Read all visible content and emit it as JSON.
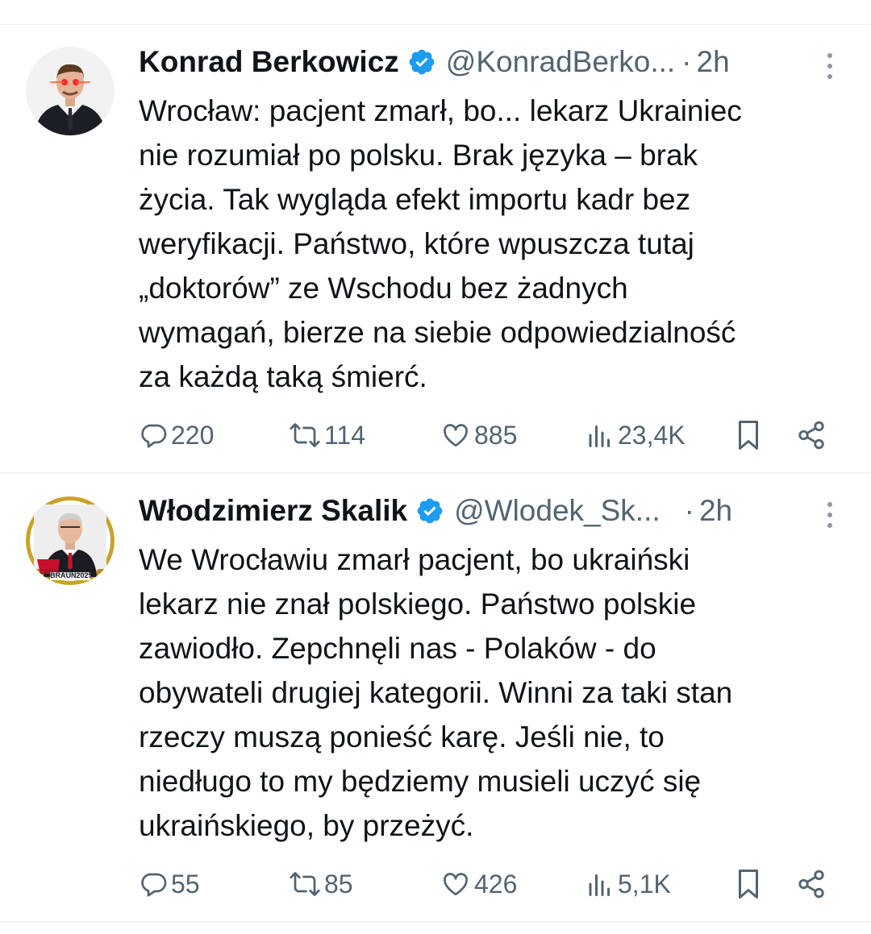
{
  "tweets": [
    {
      "display_name": "Konrad Berkowicz",
      "handle": "@KonradBerko...",
      "dot": "·",
      "time": "2h",
      "text": "Wrocław: pacjent zmarł, bo... lekarz Ukrainiec\nnie rozumiał po polsku. Brak języka – brak\nżycia. Tak wygląda efekt importu kadr bez\nweryfikacji. Państwo, które wpuszcza tutaj\n„doktorów” ze Wschodu bez żadnych\nwymagań, bierze na siebie odpowiedzialność\nza każdą taką śmierć.",
      "replies": "220",
      "reposts": "114",
      "likes": "885",
      "views": "23,4K"
    },
    {
      "display_name": "Włodzimierz Skalik",
      "handle": "@Wlodek_Sk...",
      "dot": "·",
      "time": "2h",
      "text": "We Wrocławiu zmarł pacjent, bo ukraiński\nlekarz nie znał polskiego. Państwo polskie\nzawiodło. Zepchnęli nas - Polaków - do\nobywateli drugiej kategorii. Winni za taki stan\nrzeczy muszą ponieść karę. Jeśli nie, to\nniedługo to my będziemy musieli uczyć się\nukraińskiego, by przeżyć.",
      "replies": "55",
      "reposts": "85",
      "likes": "426",
      "views": "5,1K",
      "avatar_banner": "BRAUN2025"
    }
  ],
  "icons": {
    "verified": "verified-badge-icon",
    "more": "more-vertical-icon",
    "reply": "reply-icon",
    "repost": "repost-icon",
    "like": "like-icon",
    "views": "views-icon",
    "bookmark": "bookmark-icon",
    "share": "share-icon"
  },
  "colors": {
    "verified_blue": "#1d9bf0",
    "secondary_text": "#536471",
    "primary_text": "#0f1419",
    "divider": "#eff3f4"
  }
}
